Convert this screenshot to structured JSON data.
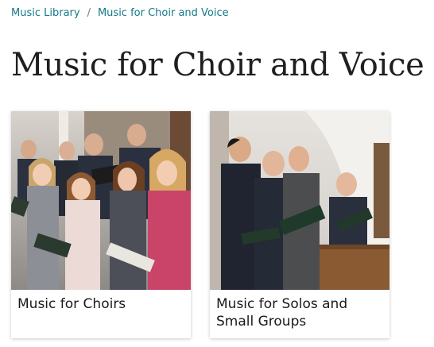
{
  "breadcrumb": {
    "items": [
      {
        "label": "Music Library"
      },
      {
        "label": "Music for Choir and Voice"
      }
    ],
    "separator": "/"
  },
  "page": {
    "title": "Music for Choir and Voice"
  },
  "cards": [
    {
      "label": "Music for Choirs",
      "image": "photo of a choir singing with music folders"
    },
    {
      "label": "Music for Solos and Small Groups",
      "image": "photo of a small group of men singing from music folders"
    }
  ],
  "colors": {
    "link": "#157a8a",
    "title": "#1f1f1f",
    "background": "#ffffff"
  }
}
